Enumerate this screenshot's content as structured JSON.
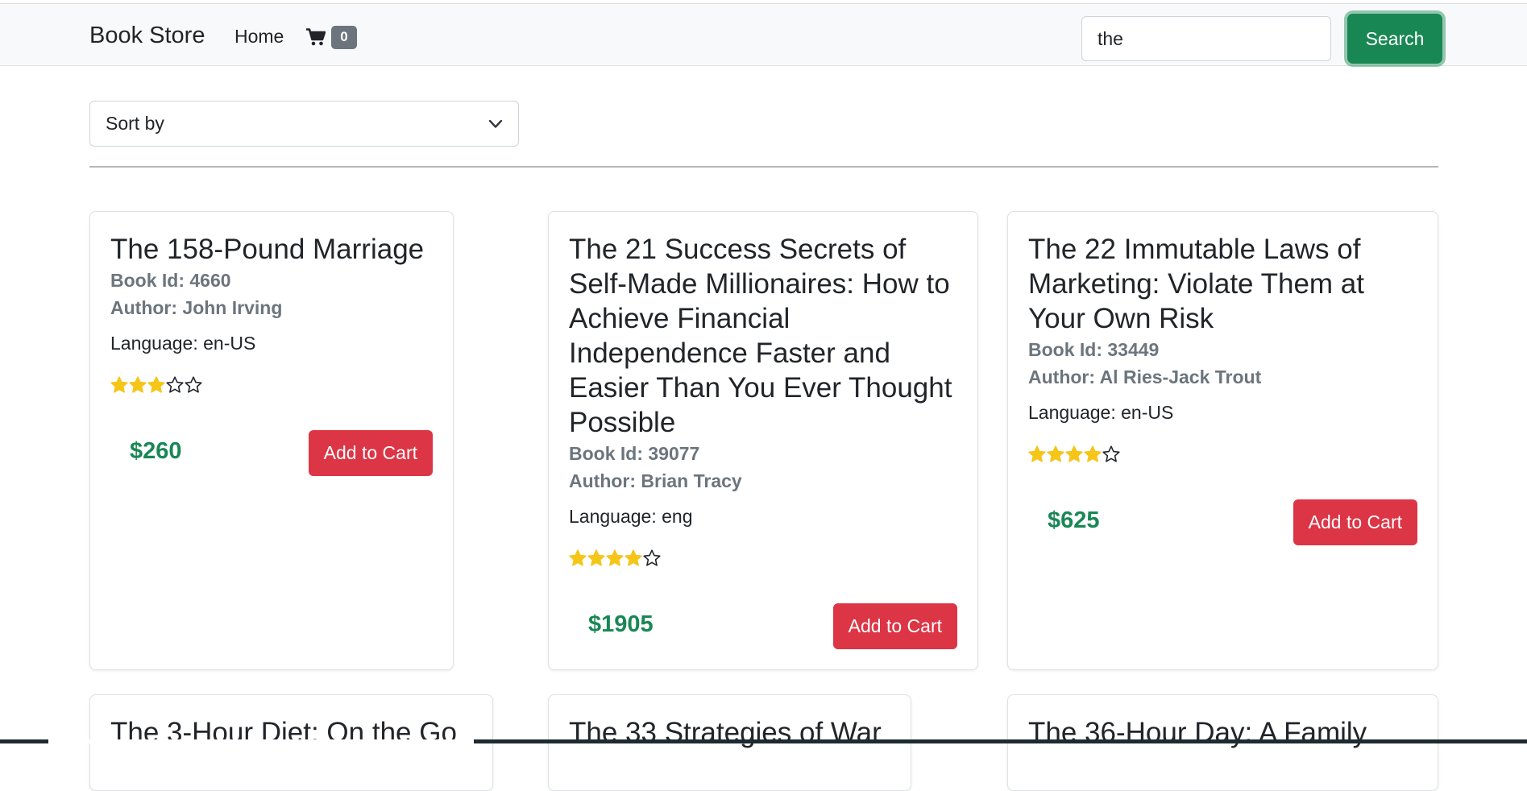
{
  "navbar": {
    "brand": "Book Store",
    "home_label": "Home",
    "cart_icon": "shopping-cart-icon",
    "cart_count": "0",
    "search_value": "the",
    "search_button": "Search"
  },
  "sort": {
    "label": "Sort by",
    "icon": "chevron-down-icon"
  },
  "colors": {
    "price": "#198754",
    "add_button": "#dc3545",
    "search_button": "#198754",
    "star_filled": "#f5c518",
    "badge": "#6c757d"
  },
  "books": [
    {
      "title": "The 158-Pound Marriage",
      "book_id": "Book Id: 4660",
      "author": "Author: John Irving",
      "language": "Language: en-US",
      "rating": 3,
      "price": "$260",
      "button": "Add to Cart"
    },
    {
      "title": "The 21 Success Secrets of Self-Made Millionaires: How to Achieve Financial Independence Faster and Easier Than You Ever Thought Possible",
      "book_id": "Book Id: 39077",
      "author": "Author: Brian Tracy",
      "language": "Language: eng",
      "rating": 4,
      "price": "$1905",
      "button": "Add to Cart"
    },
    {
      "title": "The 22 Immutable Laws of Marketing: Violate Them at Your Own Risk",
      "book_id": "Book Id: 33449",
      "author": "Author: Al Ries-Jack Trout",
      "language": "Language: en-US",
      "rating": 4,
      "price": "$625",
      "button": "Add to Cart"
    },
    {
      "title": "The 3-Hour Diet: On the Go"
    },
    {
      "title": "The 33 Strategies of War"
    },
    {
      "title": "The 36-Hour Day: A Family"
    }
  ]
}
